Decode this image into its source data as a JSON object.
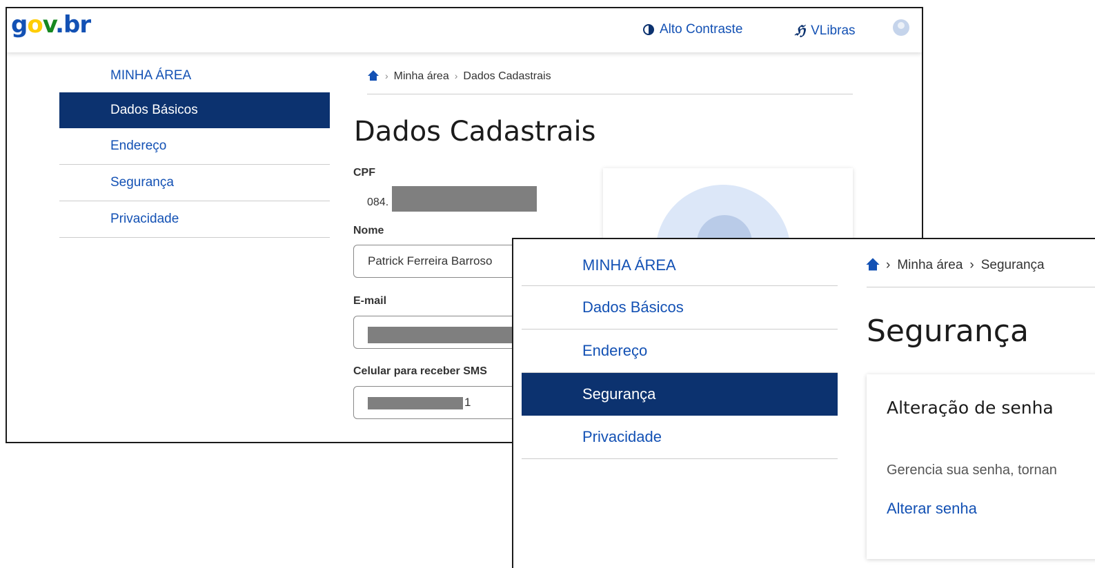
{
  "screen1": {
    "header": {
      "logo": "gov.br",
      "contrast_label": "Alto Contraste",
      "vlibras_label": "VLibras",
      "vlibras_glyph": "ℌ"
    },
    "sidebar": {
      "title": "MINHA ÁREA",
      "items": [
        {
          "label": "Dados Básicos",
          "active": true
        },
        {
          "label": "Endereço",
          "active": false
        },
        {
          "label": "Segurança",
          "active": false
        },
        {
          "label": "Privacidade",
          "active": false
        }
      ]
    },
    "breadcrumb": [
      "Minha área",
      "Dados Cadastrais"
    ],
    "page_title": "Dados Cadastrais",
    "form": {
      "cpf_label": "CPF",
      "cpf_value": "084.",
      "nome_label": "Nome",
      "nome_value": "Patrick Ferreira Barroso",
      "email_label": "E-mail",
      "celular_label": "Celular para receber SMS",
      "celular_value_suffix": "1"
    }
  },
  "screen2": {
    "sidebar": {
      "title": "MINHA ÁREA",
      "items": [
        {
          "label": "Dados Básicos",
          "active": false
        },
        {
          "label": "Endereço",
          "active": false
        },
        {
          "label": "Segurança",
          "active": true
        },
        {
          "label": "Privacidade",
          "active": false
        }
      ]
    },
    "breadcrumb": [
      "Minha área",
      "Segurança"
    ],
    "page_title": "Segurança",
    "card": {
      "title": "Alteração de senha",
      "description": "Gerencia sua senha, tornan",
      "link": "Alterar senha"
    }
  },
  "colors": {
    "primary_blue": "#1351b4",
    "active_nav": "#0c326f",
    "redaction": "#7f7f7f"
  }
}
